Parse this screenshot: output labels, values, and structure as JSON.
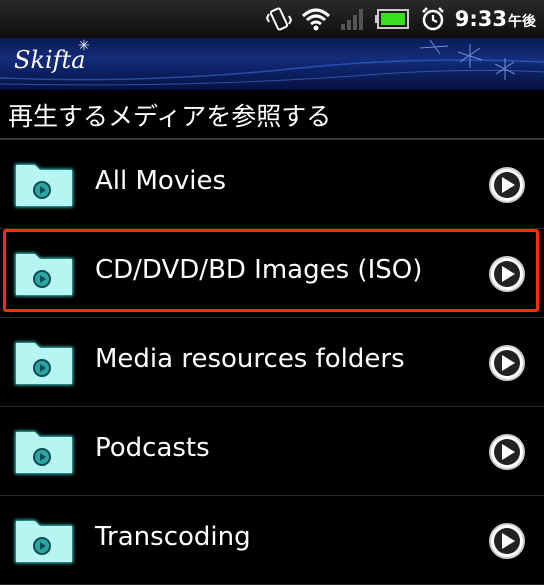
{
  "status_bar": {
    "time": "9:33",
    "time_suffix": "午後",
    "icons": [
      "vibrate-icon",
      "wifi-icon",
      "signal-icon",
      "battery-icon",
      "alarm-icon"
    ]
  },
  "banner": {
    "logo": "Skifta"
  },
  "header": {
    "title": "再生するメディアを参照する"
  },
  "list": {
    "items": [
      {
        "label": "All Movies",
        "icon": "folder-video-icon",
        "action_icon": "play-arrow-icon"
      },
      {
        "label": "CD/DVD/BD Images (ISO)",
        "icon": "folder-video-icon",
        "action_icon": "play-arrow-icon",
        "highlighted": true
      },
      {
        "label": "Media resources folders",
        "icon": "folder-video-icon",
        "action_icon": "play-arrow-icon"
      },
      {
        "label": "Podcasts",
        "icon": "folder-video-icon",
        "action_icon": "play-arrow-icon"
      },
      {
        "label": "Transcoding",
        "icon": "folder-video-icon",
        "action_icon": "play-arrow-icon"
      }
    ]
  },
  "colors": {
    "highlight": "#ff2a00",
    "folder": "#a8f0ee",
    "banner": "#0b1f5e"
  }
}
